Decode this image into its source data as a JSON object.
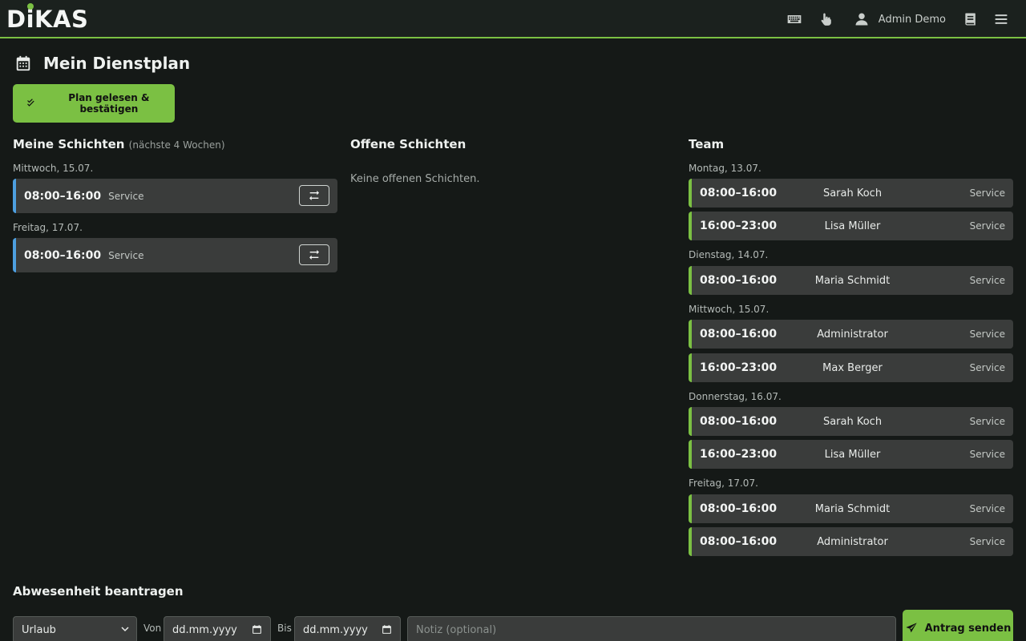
{
  "header": {
    "logo_text_pre": "D",
    "logo_text_i": "i",
    "logo_text_post": "KAS",
    "icons": [
      "keyboard-icon",
      "touch-icon",
      "user-icon",
      "book-icon",
      "menu-icon"
    ],
    "user_name": "Admin Demo"
  },
  "page": {
    "title": "Mein Dienstplan",
    "confirm_label": "Plan gelesen & bestätigen"
  },
  "my_shifts": {
    "title": "Meine Schichten",
    "subtitle": "(nächste 4 Wochen)",
    "days": [
      {
        "label": "Mittwoch, 15.07.",
        "shifts": [
          {
            "time": "08:00–16:00",
            "role": "Service"
          }
        ]
      },
      {
        "label": "Freitag, 17.07.",
        "shifts": [
          {
            "time": "08:00–16:00",
            "role": "Service"
          }
        ]
      }
    ]
  },
  "open_shifts": {
    "title": "Offene Schichten",
    "empty_text": "Keine offenen Schichten."
  },
  "team": {
    "title": "Team",
    "days": [
      {
        "label": "Montag, 13.07.",
        "shifts": [
          {
            "time": "08:00–16:00",
            "person": "Sarah Koch",
            "role": "Service"
          },
          {
            "time": "16:00–23:00",
            "person": "Lisa Müller",
            "role": "Service"
          }
        ]
      },
      {
        "label": "Dienstag, 14.07.",
        "shifts": [
          {
            "time": "08:00–16:00",
            "person": "Maria Schmidt",
            "role": "Service"
          }
        ]
      },
      {
        "label": "Mittwoch, 15.07.",
        "shifts": [
          {
            "time": "08:00–16:00",
            "person": "Administrator",
            "role": "Service"
          },
          {
            "time": "16:00–23:00",
            "person": "Max Berger",
            "role": "Service"
          }
        ]
      },
      {
        "label": "Donnerstag, 16.07.",
        "shifts": [
          {
            "time": "08:00–16:00",
            "person": "Sarah Koch",
            "role": "Service"
          },
          {
            "time": "16:00–23:00",
            "person": "Lisa Müller",
            "role": "Service"
          }
        ]
      },
      {
        "label": "Freitag, 17.07.",
        "shifts": [
          {
            "time": "08:00–16:00",
            "person": "Maria Schmidt",
            "role": "Service"
          },
          {
            "time": "08:00–16:00",
            "person": "Administrator",
            "role": "Service"
          }
        ]
      }
    ]
  },
  "absence": {
    "title": "Abwesenheit beantragen",
    "type_value": "Urlaub",
    "from_label": "Von",
    "from_placeholder": "dd.mm.yyyy",
    "to_label": "Bis",
    "to_placeholder": "dd.mm.yyyy",
    "note_placeholder": "Notiz (optional)",
    "submit_label": "Antrag senden"
  },
  "colors": {
    "accent": "#7bc043",
    "my_shift_accent": "#4d9fe0",
    "background": "#151917",
    "card": "#3a3c3b"
  }
}
